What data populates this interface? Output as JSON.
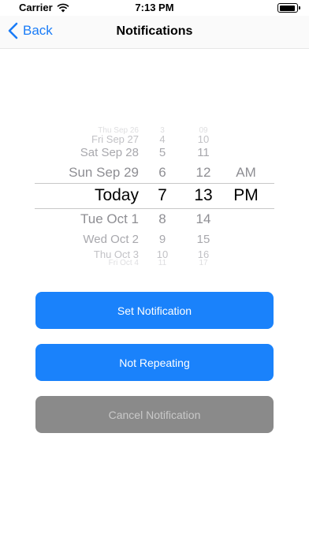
{
  "status_bar": {
    "carrier": "Carrier",
    "time": "7:13 PM"
  },
  "nav": {
    "back_label": "Back",
    "title": "Notifications"
  },
  "picker": {
    "dates": [
      "Thu Sep 26",
      "Fri Sep 27",
      "Sat Sep 28",
      "Sun Sep 29",
      "Today",
      "Tue Oct 1",
      "Wed Oct 2",
      "Thu Oct 3",
      "Fri Oct 4"
    ],
    "hours": [
      "3",
      "4",
      "5",
      "6",
      "7",
      "8",
      "9",
      "10",
      "11"
    ],
    "minutes": [
      "09",
      "10",
      "11",
      "12",
      "13",
      "14",
      "15",
      "16",
      "17"
    ],
    "ampm": [
      "AM",
      "PM"
    ],
    "selected": {
      "date": "Today",
      "hour": "7",
      "minute": "13",
      "ampm": "PM"
    }
  },
  "buttons": {
    "set_notification": "Set Notification",
    "not_repeating": "Not Repeating",
    "cancel_notification": "Cancel Notification"
  },
  "colors": {
    "accent": "#1a82fb",
    "disabled": "#8a8a8a"
  }
}
